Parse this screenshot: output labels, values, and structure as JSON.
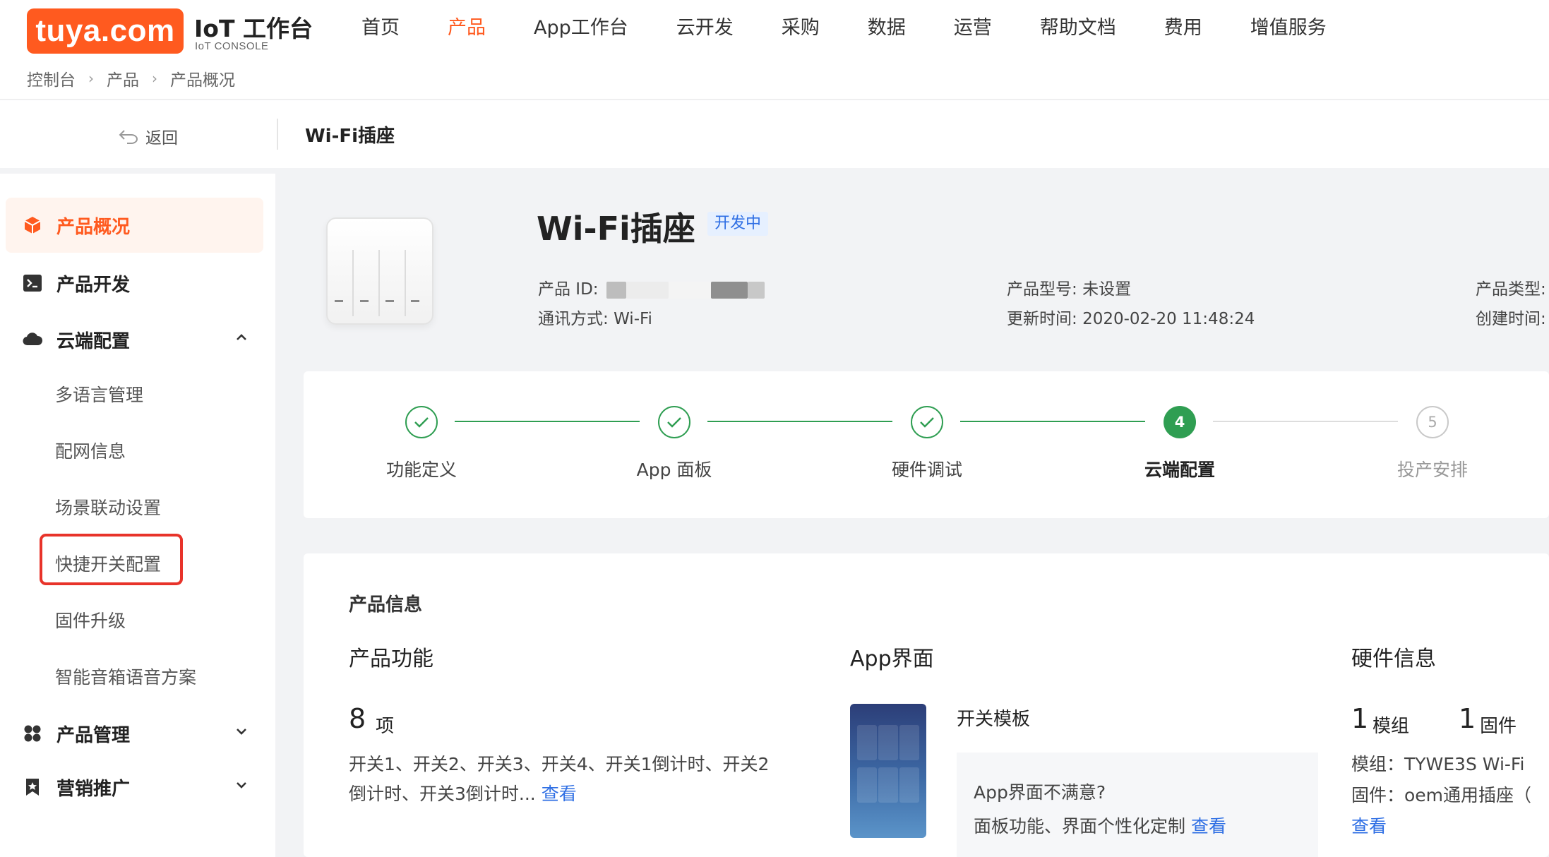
{
  "header": {
    "logo_text": "tuya.com",
    "console_title": "IoT 工作台",
    "console_subtitle": "IoT CONSOLE",
    "nav": [
      {
        "label": "首页",
        "active": false
      },
      {
        "label": "产品",
        "active": true
      },
      {
        "label": "App工作台",
        "active": false
      },
      {
        "label": "云开发",
        "active": false
      },
      {
        "label": "采购",
        "active": false
      },
      {
        "label": "数据",
        "active": false
      },
      {
        "label": "运营",
        "active": false
      },
      {
        "label": "帮助文档",
        "active": false
      },
      {
        "label": "费用",
        "active": false
      },
      {
        "label": "增值服务",
        "active": false
      }
    ],
    "breadcrumb": [
      "控制台",
      "产品",
      "产品概况"
    ]
  },
  "subheader": {
    "back_label": "返回",
    "title": "Wi-Fi插座"
  },
  "sidebar": {
    "items": [
      {
        "label": "产品概况",
        "icon": "cube-icon",
        "active": true
      },
      {
        "label": "产品开发",
        "icon": "terminal-icon",
        "active": false
      },
      {
        "label": "云端配置",
        "icon": "cloud-icon",
        "active": false,
        "expanded": true
      }
    ],
    "sub_items": [
      "多语言管理",
      "配网信息",
      "场景联动设置",
      "快捷开关配置",
      "固件升级",
      "智能音箱语音方案"
    ],
    "highlighted_sub_item": "快捷开关配置",
    "collapsed_items": [
      {
        "label": "产品管理",
        "icon": "grid-icon"
      },
      {
        "label": "营销推广",
        "icon": "bookmark-icon"
      }
    ]
  },
  "product": {
    "name": "Wi-Fi插座",
    "status": "开发中",
    "id_label": "产品 ID:",
    "comm_label": "通讯方式:",
    "comm_value": "Wi-Fi",
    "model_label": "产品型号:",
    "model_value": "未设置",
    "updated_label": "更新时间:",
    "updated_value": "2020-02-20 11:48:24",
    "type_label": "产品类型:",
    "created_label": "创建时间:"
  },
  "steps": [
    {
      "label": "功能定义",
      "state": "done"
    },
    {
      "label": "App 面板",
      "state": "done"
    },
    {
      "label": "硬件调试",
      "state": "done"
    },
    {
      "label": "云端配置",
      "state": "current",
      "number": "4"
    },
    {
      "label": "投产安排",
      "state": "todo",
      "number": "5"
    }
  ],
  "info": {
    "section_title": "产品信息",
    "functions": {
      "title": "产品功能",
      "count": "8",
      "unit": "项",
      "line1": "开关1、开关2、开关3、开关4、开关1倒计时、开关2",
      "line2": "倒计时、开关3倒计时...",
      "view_link": "查看"
    },
    "app": {
      "title": "App界面",
      "template": "开关模板",
      "hint1": "App界面不满意?",
      "hint2": "面板功能、界面个性化定制",
      "view_link": "查看"
    },
    "hardware": {
      "title": "硬件信息",
      "module_count": "1",
      "module_unit": "模组",
      "firmware_count": "1",
      "firmware_unit": "固件",
      "module_line": "模组：TYWE3S Wi-Fi",
      "firmware_line": "固件：oem通用插座（",
      "view_link": "查看"
    }
  },
  "colors": {
    "brand": "#ff5a1f",
    "success": "#2f9e52",
    "link": "#2f6fe4",
    "highlight": "#e8332a"
  }
}
